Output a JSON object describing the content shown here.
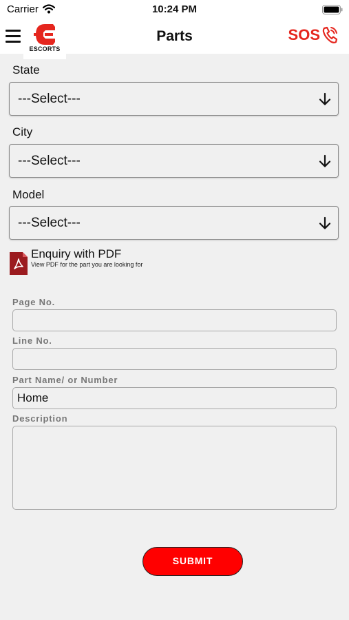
{
  "status_bar": {
    "carrier": "Carrier",
    "time": "10:24 PM"
  },
  "header": {
    "logo_text": "ESCORTS",
    "title": "Parts",
    "sos_label": "SOS"
  },
  "selects": [
    {
      "label": "State",
      "value": "---Select---"
    },
    {
      "label": "City",
      "value": "---Select---"
    },
    {
      "label": "Model",
      "value": "---Select---"
    }
  ],
  "pdf_enquiry": {
    "title": "Enquiry with PDF",
    "subtitle": "View PDF for the part you are looking for"
  },
  "fields": {
    "page_no": {
      "label": "Page No.",
      "value": ""
    },
    "line_no": {
      "label": "Line No.",
      "value": ""
    },
    "part_name": {
      "label": "Part Name/ or Number",
      "value": "Home"
    },
    "description": {
      "label": "Description",
      "value": ""
    }
  },
  "submit_label": "SUBMIT",
  "colors": {
    "brand_red": "#e5261e",
    "submit_red": "#ff0000",
    "background": "#f0f0f0"
  },
  "icons": [
    "wifi-icon",
    "battery-icon",
    "menu-icon",
    "escorts-logo",
    "phone-icon",
    "arrow-down-icon",
    "pdf-icon"
  ]
}
